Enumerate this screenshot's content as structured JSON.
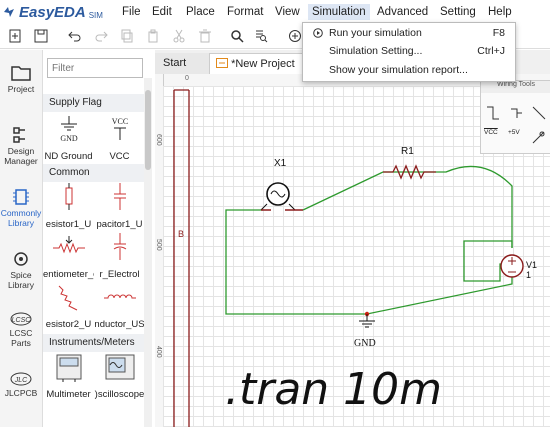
{
  "app": {
    "logo": "EasyEDA",
    "logo_sub": "SIM"
  },
  "menu": [
    "File",
    "Edit",
    "Place",
    "Format",
    "View",
    "Simulation",
    "Advanced",
    "Setting",
    "Help"
  ],
  "simulation_menu": [
    {
      "label": "Run your simulation",
      "shortcut": "F8",
      "icon": "play-icon"
    },
    {
      "label": "Simulation Setting...",
      "shortcut": "Ctrl+J",
      "icon": ""
    },
    {
      "label": "Show your simulation report...",
      "shortcut": "",
      "icon": ""
    }
  ],
  "leftnav": [
    {
      "label1": "Project",
      "label2": "",
      "icon": "folder-icon"
    },
    {
      "label1": "Design",
      "label2": "Manager",
      "icon": "design-manager-icon"
    },
    {
      "label1": "Commonly",
      "label2": "Library",
      "icon": "chip-icon"
    },
    {
      "label1": "Spice",
      "label2": "Library",
      "icon": "spice-icon"
    },
    {
      "label1": "LCSC",
      "label2": "Parts",
      "icon": "lcsc-icon"
    },
    {
      "label1": "JLCPCB",
      "label2": "",
      "icon": "jlcpcb-icon"
    }
  ],
  "library": {
    "filter_placeholder": "Filter",
    "supply_flag": "Supply Flag",
    "common": "Common",
    "instruments": "Instruments/Meters",
    "cells": {
      "gnd": "ND Ground",
      "vcc": "VCC",
      "resistor1": "esistor1_U",
      "capacitor1": "pacitor1_U",
      "potentiometer": "entiometer_o",
      "electrolytic": "r_Electrol",
      "resistor2": "esistor2_U",
      "inductor": "nductor_US",
      "multimeter": "Multimeter",
      "oscilloscope": ")scilloscope"
    },
    "gnd_symbol_text": "GND",
    "vcc_symbol_text": "VCC"
  },
  "tabs": {
    "start": "Start",
    "project": "*New Project"
  },
  "ruler": {
    "top": [
      "0"
    ],
    "left": [
      "600",
      "500",
      "400"
    ]
  },
  "wiring_tools": {
    "title": "Wiring Tools",
    "vcc": "VCC",
    "plus5v": "+5V"
  },
  "schematic": {
    "lamp_label": "X1",
    "resistor_label": "R1",
    "source_label": "V1",
    "source_value": "1",
    "gnd_label": "GND",
    "border_letter": "B",
    "directive": ".tran 10m"
  }
}
